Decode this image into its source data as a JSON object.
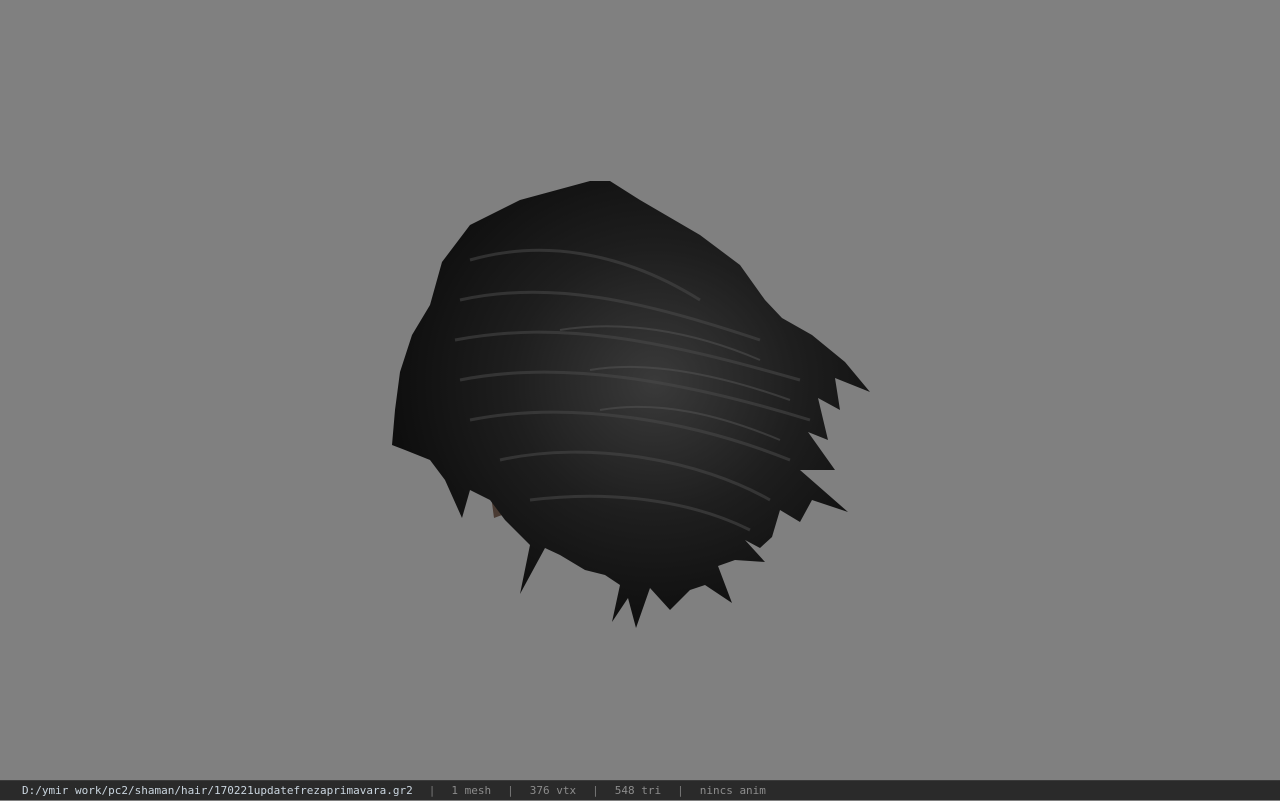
{
  "viewer": {
    "background_color": "#808080",
    "model_name": "hair-mesh"
  },
  "statusbar": {
    "file_path": "D:/ymir work/pc2/shaman/hair/170221updatefrezaprimavara.gr2",
    "separator": "|",
    "mesh_count": "1 mesh",
    "vertex_count": "376 vtx",
    "triangle_count": "548 tri",
    "anim_status": "nincs anim"
  }
}
